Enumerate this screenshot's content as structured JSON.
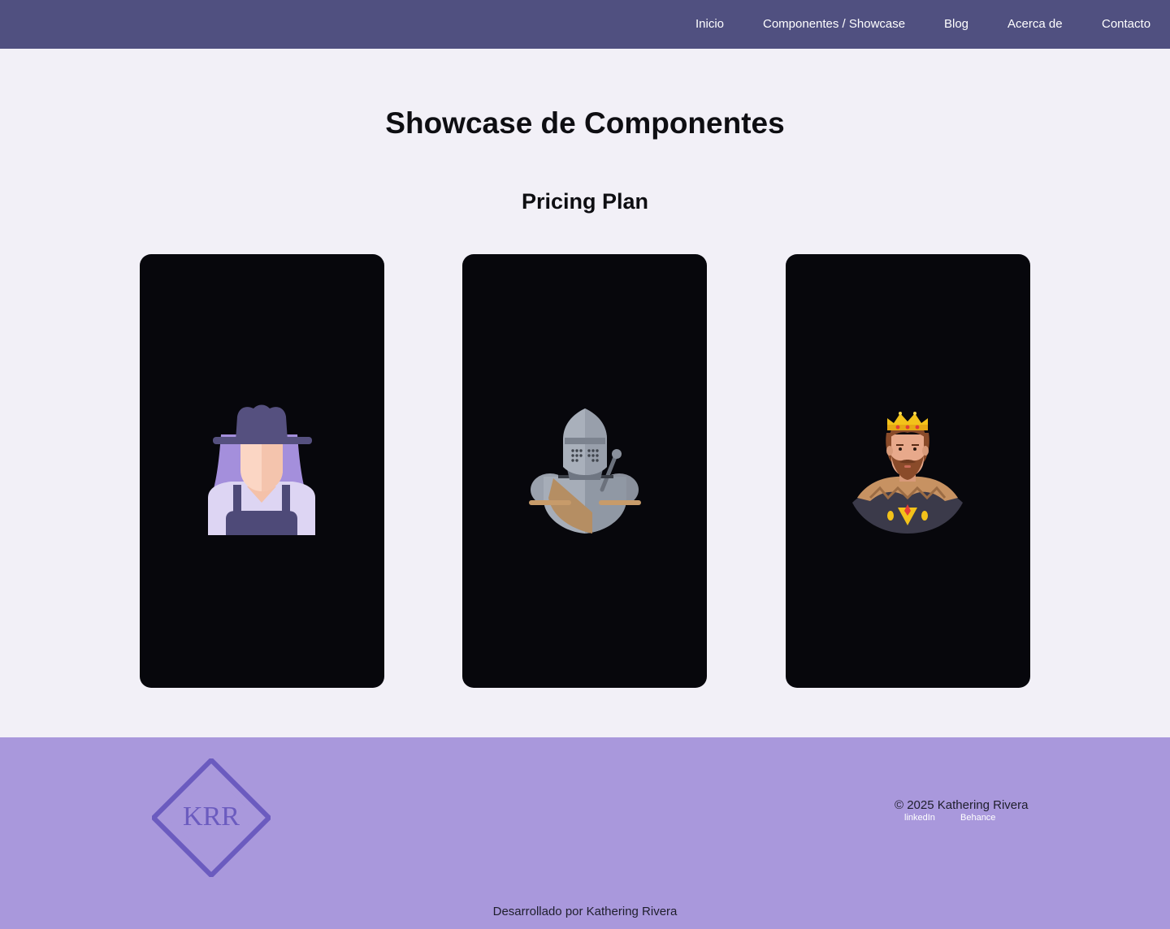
{
  "nav": {
    "items": [
      {
        "label": "Inicio"
      },
      {
        "label": "Componentes / Showcase"
      },
      {
        "label": "Blog"
      },
      {
        "label": "Acerca de"
      },
      {
        "label": "Contacto"
      }
    ]
  },
  "main": {
    "title": "Showcase de Componentes",
    "section_title": "Pricing Plan",
    "cards": [
      {
        "icon": "farmer-woman-avatar-icon"
      },
      {
        "icon": "knight-armor-avatar-icon"
      },
      {
        "icon": "king-avatar-icon"
      }
    ]
  },
  "footer": {
    "logo_text": "KRR",
    "copyright": "© 2025 Kathering Rivera",
    "social": [
      {
        "label": "linkedIn"
      },
      {
        "label": "Behance"
      }
    ],
    "credit": "Desarrollado por Kathering Rivera"
  },
  "colors": {
    "header_bg": "#505080",
    "page_bg": "#f2f0f7",
    "card_bg": "#07070c",
    "footer_bg": "#a998dc",
    "logo_accent": "#6b5bbf"
  }
}
